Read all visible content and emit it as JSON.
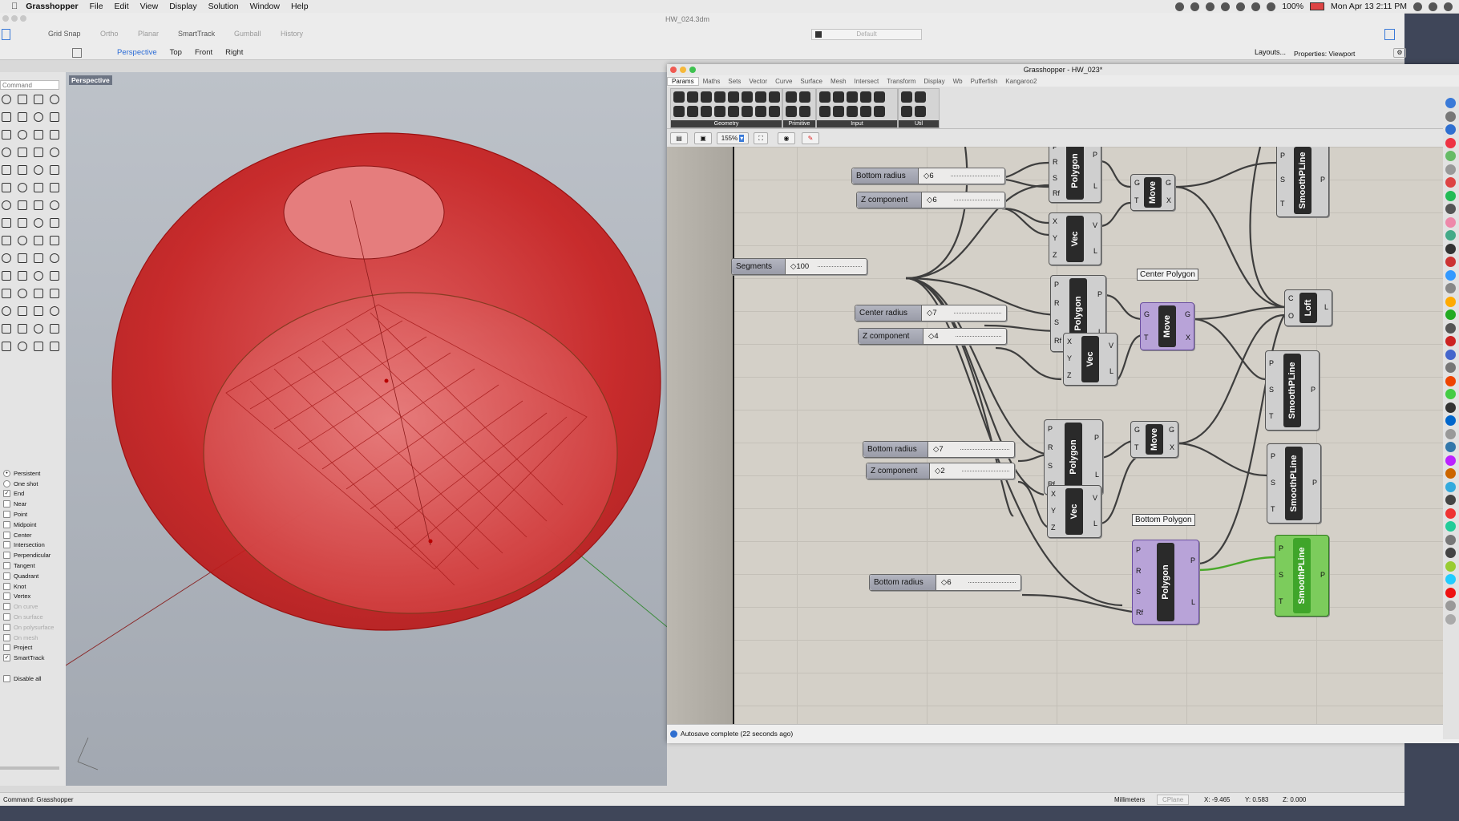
{
  "menubar": {
    "app": "Grasshopper",
    "items": [
      "File",
      "Edit",
      "View",
      "Display",
      "Solution",
      "Window",
      "Help"
    ],
    "battery": "100%",
    "clock": "Mon Apr 13  2:11 PM"
  },
  "rhino": {
    "doc_title": "HW_024.3dm",
    "toolbar": {
      "grid_snap": "Grid Snap",
      "ortho": "Ortho",
      "planar": "Planar",
      "smarttrack": "SmartTrack",
      "gumball": "Gumball",
      "history": "History",
      "layer": "Default"
    },
    "viewport_tabs": [
      "Perspective",
      "Top",
      "Front",
      "Right"
    ],
    "layouts": "Layouts...",
    "properties": "Properties: Viewport",
    "command_placeholder": "Command",
    "viewport_label": "Perspective",
    "snaps": [
      {
        "label": "Persistent",
        "kind": "radio",
        "checked": true,
        "dim": false
      },
      {
        "label": "One shot",
        "kind": "radio",
        "checked": false,
        "dim": false
      },
      {
        "label": "End",
        "kind": "check",
        "checked": true,
        "dim": false
      },
      {
        "label": "Near",
        "kind": "check",
        "checked": false,
        "dim": false
      },
      {
        "label": "Point",
        "kind": "check",
        "checked": false,
        "dim": false
      },
      {
        "label": "Midpoint",
        "kind": "check",
        "checked": false,
        "dim": false
      },
      {
        "label": "Center",
        "kind": "check",
        "checked": false,
        "dim": false
      },
      {
        "label": "Intersection",
        "kind": "check",
        "checked": false,
        "dim": false
      },
      {
        "label": "Perpendicular",
        "kind": "check",
        "checked": false,
        "dim": false
      },
      {
        "label": "Tangent",
        "kind": "check",
        "checked": false,
        "dim": false
      },
      {
        "label": "Quadrant",
        "kind": "check",
        "checked": false,
        "dim": false
      },
      {
        "label": "Knot",
        "kind": "check",
        "checked": false,
        "dim": false
      },
      {
        "label": "Vertex",
        "kind": "check",
        "checked": false,
        "dim": false
      },
      {
        "label": "On curve",
        "kind": "check",
        "checked": false,
        "dim": true
      },
      {
        "label": "On surface",
        "kind": "check",
        "checked": false,
        "dim": true
      },
      {
        "label": "On polysurface",
        "kind": "check",
        "checked": false,
        "dim": true
      },
      {
        "label": "On mesh",
        "kind": "check",
        "checked": false,
        "dim": true
      },
      {
        "label": "Project",
        "kind": "check",
        "checked": false,
        "dim": false
      },
      {
        "label": "SmartTrack",
        "kind": "check",
        "checked": true,
        "dim": false
      },
      {
        "label": "",
        "kind": "space",
        "checked": false,
        "dim": false
      },
      {
        "label": "Disable all",
        "kind": "check",
        "checked": false,
        "dim": false
      }
    ],
    "status": {
      "command": "Command: Grasshopper",
      "units": "Millimeters",
      "cplane": "CPlane",
      "x": "X: -9.465",
      "y": "Y: 0.583",
      "z": "Z: 0.000"
    }
  },
  "gh": {
    "title": "Grasshopper - HW_023*",
    "tabs": [
      "Params",
      "Maths",
      "Sets",
      "Vector",
      "Curve",
      "Surface",
      "Mesh",
      "Intersect",
      "Transform",
      "Display",
      "Wb",
      "Pufferfish",
      "Kangaroo2"
    ],
    "ribbon_groups": [
      "Geometry",
      "Primitive",
      "Input",
      "Util"
    ],
    "zoom": "155%",
    "status": "Autosave complete (22 seconds ago)",
    "sliders": [
      {
        "label": "Bottom radius",
        "value": "6"
      },
      {
        "label": "Z component",
        "value": "6"
      },
      {
        "label": "Segments",
        "value": "100"
      },
      {
        "label": "Center radius",
        "value": "7"
      },
      {
        "label": "Z component",
        "value": "4"
      },
      {
        "label": "Bottom radius",
        "value": "7"
      },
      {
        "label": "Z component",
        "value": "2"
      },
      {
        "label": "Bottom radius",
        "value": "6"
      }
    ],
    "groups": {
      "center": "Center Polygon",
      "bottom": "Bottom Polygon"
    },
    "components": {
      "polygon": "Polygon",
      "vec": "Vec",
      "move": "Move",
      "loft": "Loft",
      "smooth": "SmoothPLine"
    },
    "ports": {
      "polygon_in": [
        "P",
        "R",
        "S",
        "Rf"
      ],
      "polygon_out": [
        "P",
        "L"
      ],
      "vec_in": [
        "X",
        "Y",
        "Z"
      ],
      "vec_out": [
        "V",
        "L"
      ],
      "move_in": [
        "G",
        "T"
      ],
      "move_out": [
        "G",
        "X"
      ],
      "loft_in": [
        "C",
        "O"
      ],
      "loft_out": [
        "L"
      ],
      "smooth_in": [
        "P",
        "S",
        "T"
      ],
      "smooth_out": [
        "P"
      ]
    }
  }
}
